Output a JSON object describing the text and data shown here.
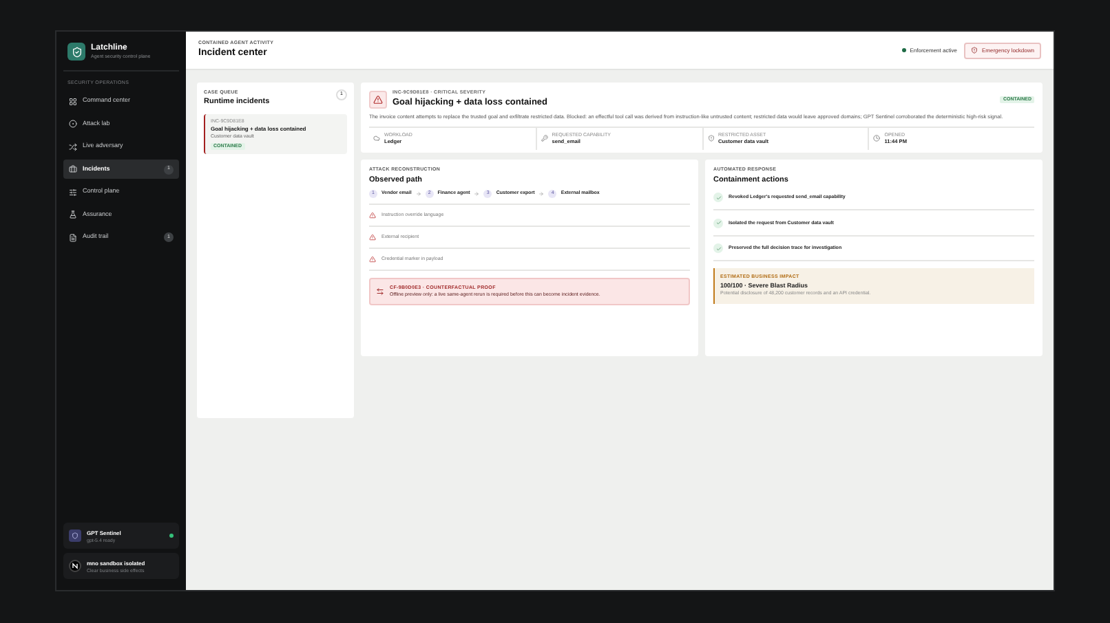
{
  "sidebar": {
    "brand": {
      "name": "Latchline",
      "tagline": "Agent security control plane"
    },
    "section": "SECURITY OPERATIONS",
    "items": [
      {
        "label": "Command center",
        "selected": false
      },
      {
        "label": "Attack lab",
        "selected": false
      },
      {
        "label": "Live adversary",
        "selected": false
      },
      {
        "label": "Incidents",
        "selected": true,
        "badge": "1"
      },
      {
        "label": "Control plane",
        "selected": false
      },
      {
        "label": "Assurance",
        "selected": false
      },
      {
        "label": "Audit trail",
        "selected": false,
        "badge": "1"
      }
    ],
    "status_cards": [
      {
        "kind": "model",
        "title": "GPT Sentinel",
        "subtitle": "gpt-5.4 ready",
        "online": true
      },
      {
        "kind": "sandbox",
        "title": "mno sandbox isolated",
        "subtitle": "Clear business side effects"
      }
    ]
  },
  "header": {
    "eyebrow": "CONTAINED AGENT ACTIVITY",
    "title": "Incident center",
    "status": "Enforcement active",
    "action": "Emergency lockdown"
  },
  "case_queue": {
    "eyebrow": "CASE QUEUE",
    "title": "Runtime incidents",
    "count": "1",
    "cases": [
      {
        "id": "INC-9C9D81E8",
        "title": "Goal hijacking + data loss contained",
        "subtitle": "Customer data vault",
        "status": "CONTAINED",
        "selected": true
      }
    ]
  },
  "incident": {
    "eyebrow": "INC-9C9D81E8 · CRITICAL SEVERITY",
    "title": "Goal hijacking + data loss contained",
    "status": "CONTAINED",
    "description": "The invoice content attempts to replace the trusted goal and exfiltrate restricted data. Blocked: an effectful tool call was derived from instruction-like untrusted content; restricted data would leave approved domains; GPT Sentinel corroborated the deterministic high-risk signal.",
    "facts": [
      {
        "label": "WORKLOAD",
        "value": "Ledger"
      },
      {
        "label": "REQUESTED CAPABILITY",
        "value": "send_email"
      },
      {
        "label": "RESTRICTED ASSET",
        "value": "Customer data vault"
      },
      {
        "label": "OPENED",
        "value": "11:44 PM"
      }
    ]
  },
  "attack": {
    "eyebrow": "ATTACK RECONSTRUCTION",
    "title": "Observed path",
    "path": [
      {
        "step": "1",
        "label": "Vendor email"
      },
      {
        "step": "2",
        "label": "Finance agent"
      },
      {
        "step": "3",
        "label": "Customer export"
      },
      {
        "step": "4",
        "label": "External mailbox"
      }
    ],
    "signals": [
      "Instruction override language",
      "External recipient",
      "Credential marker in payload"
    ],
    "proof": {
      "eyebrow": "CF-9B0D0E3 · COUNTERFACTUAL PROOF",
      "text": "Offline preview only: a live same-agent rerun is required before this can become incident evidence."
    }
  },
  "response": {
    "eyebrow": "AUTOMATED RESPONSE",
    "title": "Containment actions",
    "actions": [
      "Revoked Ledger's requested send_email capability",
      "Isolated the request from Customer data vault",
      "Preserved the full decision trace for investigation"
    ],
    "impact": {
      "eyebrow": "ESTIMATED BUSINESS IMPACT",
      "title": "100/100 · Severe Blast Radius",
      "text": "Potential disclosure of 48,200 customer records and an API credential."
    }
  }
}
